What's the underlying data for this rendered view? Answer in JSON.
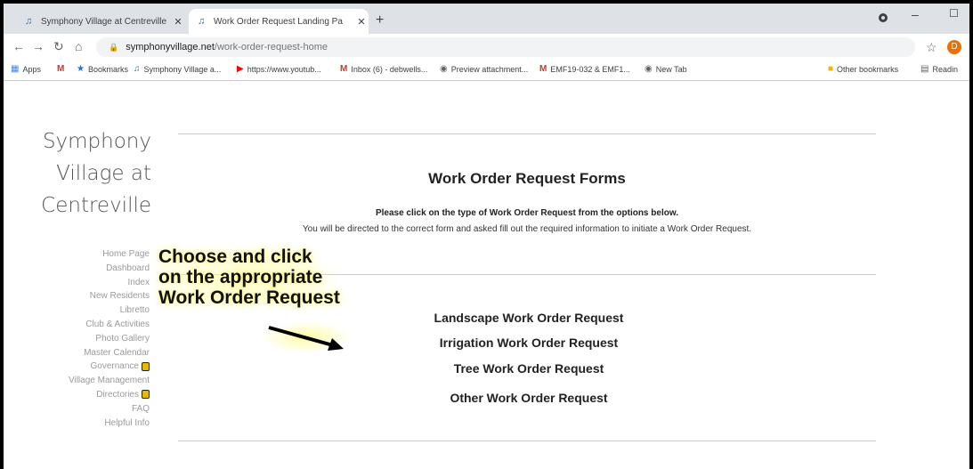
{
  "browser": {
    "tabs": [
      {
        "title": "Symphony Village at Centreville",
        "active": false
      },
      {
        "title": "Work Order Request Landing Pa",
        "active": true
      }
    ],
    "new_tab": "+",
    "url_host": "symphonyvillage.net",
    "url_path": "/work-order-request-home",
    "profile_initial": "D",
    "window_controls": {
      "minimize": "–",
      "maximize": "☐"
    }
  },
  "bookmarks": [
    {
      "label": "Apps",
      "icon": "apps-grid-icon"
    },
    {
      "label": "",
      "icon": "gmail-icon"
    },
    {
      "label": "Bookmarks",
      "icon": "star-icon"
    },
    {
      "label": "Symphony Village a...",
      "icon": "music-note-icon"
    },
    {
      "label": "https://www.youtub...",
      "icon": "youtube-icon"
    },
    {
      "label": "Inbox (6) - debwells...",
      "icon": "gmail-icon"
    },
    {
      "label": "Preview attachment...",
      "icon": "globe-icon"
    },
    {
      "label": "EMF19-032 & EMF1...",
      "icon": "gmail-icon"
    },
    {
      "label": "New Tab",
      "icon": "globe-icon"
    },
    {
      "label": "Other bookmarks",
      "icon": "folder-icon"
    },
    {
      "label": "Readin",
      "icon": "reading-list-icon"
    }
  ],
  "site": {
    "logo_lines": [
      "Symphony",
      "Village at",
      "Centreville"
    ],
    "nav": [
      "Home Page",
      "Dashboard",
      "Index",
      "New Residents",
      "Libretto",
      "Club & Activities",
      "Photo Gallery",
      "Master Calendar",
      "Governance",
      "Village Management",
      "Directories",
      "FAQ",
      "Helpful Info"
    ]
  },
  "main": {
    "title": "Work Order Request Forms",
    "instruction_bold": "Please click on the type of Work Order Request from the options below.",
    "instruction": "You will be directed to the correct form and asked fill out the required information to initiate a Work Order Request.",
    "links": [
      "Landscape Work Order Request",
      "Irrigation Work Order Request",
      "Tree Work Order Request",
      "Other Work Order Request"
    ]
  },
  "annotation": {
    "lines": [
      "Choose and click",
      "on the appropriate",
      "Work Order Request"
    ]
  },
  "colors": {
    "accent": "#1a73e8",
    "profile": "#e8710a",
    "annotation_glow": "#fffb8c"
  }
}
